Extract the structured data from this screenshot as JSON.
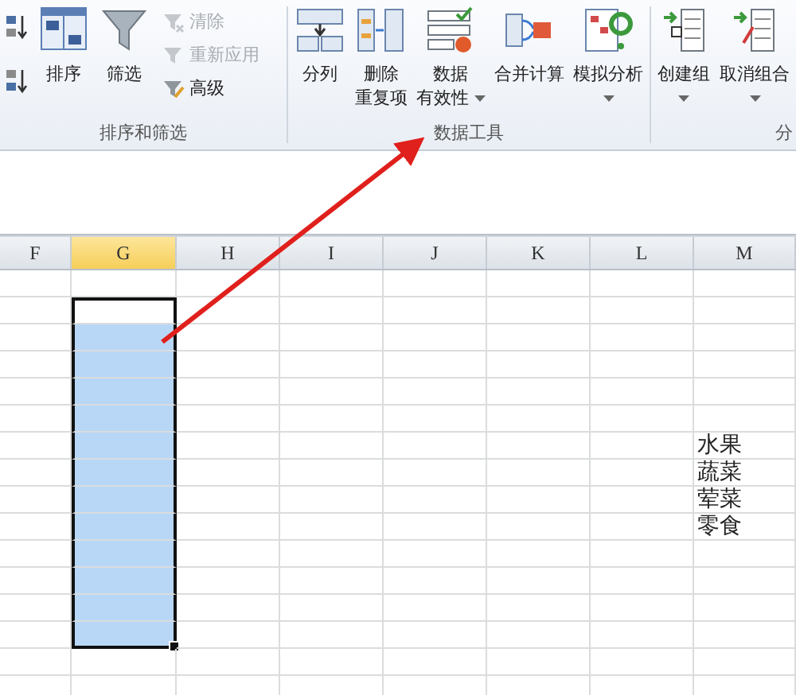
{
  "ribbon": {
    "groups": [
      {
        "label": "排序和筛选",
        "buttons": [
          {
            "kind": "sort-asc"
          },
          {
            "kind": "sort-desc"
          },
          {
            "kind": "sort",
            "lines": [
              "排序"
            ],
            "dropdown": false
          },
          {
            "kind": "filter",
            "lines": [
              "筛选"
            ],
            "dropdown": false
          },
          {
            "kind": "clear",
            "label": "清除",
            "disabled": true
          },
          {
            "kind": "reapply",
            "label": "重新应用",
            "disabled": true
          },
          {
            "kind": "advanced",
            "label": "高级",
            "disabled": false
          }
        ]
      },
      {
        "label": "数据工具",
        "buttons": [
          {
            "kind": "split",
            "lines": [
              "分列"
            ],
            "dropdown": false
          },
          {
            "kind": "dedupe",
            "lines": [
              "删除",
              "重复项"
            ],
            "dropdown": false
          },
          {
            "kind": "validate",
            "lines": [
              "数据",
              "有效性"
            ],
            "dropdown": true
          },
          {
            "kind": "consolidate",
            "lines": [
              "合并计算"
            ],
            "dropdown": false
          },
          {
            "kind": "whatif",
            "lines": [
              "模拟分析"
            ],
            "dropdown": true
          }
        ]
      },
      {
        "label": "分",
        "buttons": [
          {
            "kind": "group",
            "lines": [
              "创建组"
            ],
            "dropdown": true
          },
          {
            "kind": "ungroup",
            "lines": [
              "取消组合"
            ],
            "dropdown": true
          }
        ]
      }
    ]
  },
  "sheet": {
    "columns": [
      {
        "label": "F",
        "selected": false
      },
      {
        "label": "G",
        "selected": true
      },
      {
        "label": "H",
        "selected": false
      },
      {
        "label": "I",
        "selected": false
      },
      {
        "label": "J",
        "selected": false
      },
      {
        "label": "K",
        "selected": false
      },
      {
        "label": "L",
        "selected": false
      },
      {
        "label": "M",
        "selected": false
      }
    ],
    "rows": [
      {
        "selected": false
      },
      {
        "selected": true,
        "active": true
      },
      {
        "selected": true,
        "active": false
      },
      {
        "selected": true,
        "active": false
      },
      {
        "selected": true,
        "active": false
      },
      {
        "selected": true,
        "active": false
      },
      {
        "selected": true,
        "active": false,
        "M": "水果"
      },
      {
        "selected": true,
        "active": false,
        "M": "蔬菜"
      },
      {
        "selected": true,
        "active": false,
        "M": "荤菜"
      },
      {
        "selected": true,
        "active": false,
        "M": "零食"
      },
      {
        "selected": true,
        "active": false
      },
      {
        "selected": true,
        "active": false
      },
      {
        "selected": true,
        "active": false
      },
      {
        "selected": true,
        "active": false
      },
      {
        "selected": false
      },
      {
        "selected": false
      }
    ]
  }
}
